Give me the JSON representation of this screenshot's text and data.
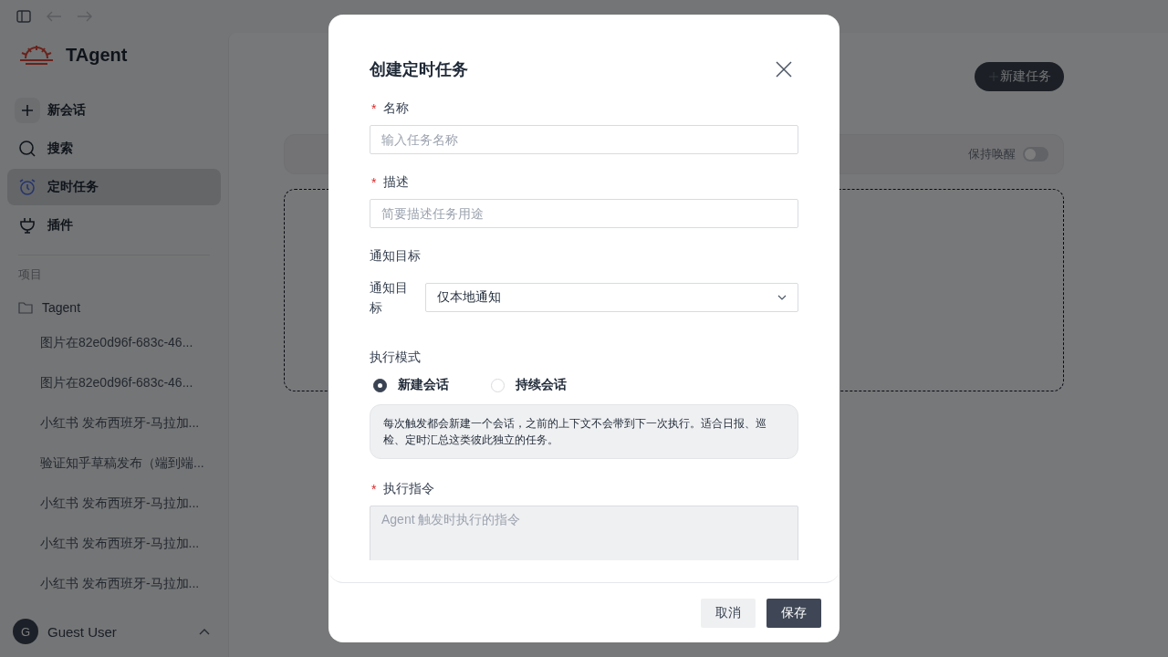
{
  "sidebar": {
    "app_name": "TAgent",
    "nav": [
      {
        "kind": "new",
        "label": "新会话",
        "selected": false
      },
      {
        "kind": "search",
        "label": "搜索",
        "selected": false
      },
      {
        "kind": "schedule",
        "label": "定时任务",
        "selected": true
      },
      {
        "kind": "plugin",
        "label": "插件",
        "selected": false
      }
    ],
    "section_label": "项目",
    "projects": [
      {
        "name": "Tagent",
        "children": [
          "图片在82e0d96f-683c-46...",
          "图片在82e0d96f-683c-46...",
          "小红书 发布西班牙-马拉加...",
          "验证知乎草稿发布（端到端...",
          "小红书 发布西班牙-马拉加...",
          "小红书 发布西班牙-马拉加...",
          "小红书 发布西班牙-马拉加..."
        ]
      }
    ],
    "user": {
      "avatar": "G",
      "name": "Guest User"
    }
  },
  "main": {
    "new_task_button": "新建任务",
    "keep_awake": {
      "label": "保持唤醒",
      "on": false
    }
  },
  "dialog": {
    "title": "创建定时任务",
    "name_field": {
      "required_mark": "*",
      "label": "名称",
      "placeholder": "输入任务名称"
    },
    "description_field": {
      "required_mark": "*",
      "label": "描述",
      "placeholder": "简要描述任务用途"
    },
    "notify": {
      "section": "通知目标",
      "label": "通知目标",
      "value": "仅本地通知"
    },
    "mode": {
      "section": "执行模式",
      "options": [
        {
          "label": "新建会话",
          "selected": true
        },
        {
          "label": "持续会话",
          "selected": false
        }
      ],
      "note": "每次触发都会新建一个会话，之前的上下文不会带到下一次执行。适合日报、巡检、定时汇总这类彼此独立的任务。"
    },
    "instruction_field": {
      "required_mark": "*",
      "label": "执行指令",
      "placeholder": "Agent 触发时执行的指令"
    },
    "buttons": [
      {
        "kind": "secondary",
        "label": "取消"
      },
      {
        "kind": "primary",
        "label": "保存"
      }
    ]
  }
}
